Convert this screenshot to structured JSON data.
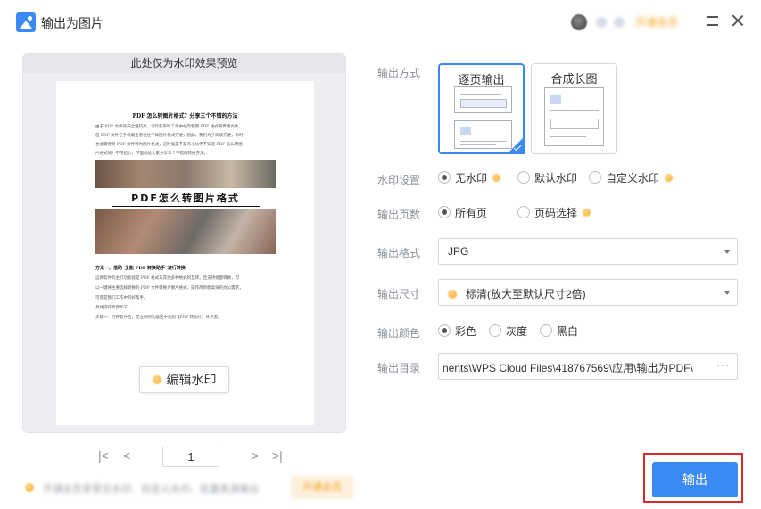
{
  "window": {
    "title": "输出为图片",
    "member_label": "开通会员"
  },
  "preview": {
    "header": "此处仅为水印效果预览",
    "doc": {
      "title": "PDF 怎么转图片格式？分享三个不错的方法",
      "intro_lines": [
        "由于 PDF 文件的安全性较高，读行在平时工作中经常使用 PDF 格式来传输文件。",
        "但 PDF 文件在手机端查看往往不如图片格式方便，因此，我们为了阅读方便，有时",
        "也会需要将 PDF 文件转为图片格式，这时候是不是有小伙伴不知道 PDF 怎么转图",
        "片格式呢？不用担心，下面就给大家分享三个不错的转换方法。"
      ],
      "banner": "PDF怎么转图片格式",
      "section_title": "方法一、借助“全能 PDF 转换助手”进行转换",
      "body_lines": [
        "这款软件的主打功能就是 PDF 格式与其他多种格式的互转，且支持批量转换，可",
        "以一键将主要选择转换的 PDF 文件转换为图片格式，操作简单能高效的办公需求，",
        "可谓是我们工作中的好帮手。",
        "具体操作步骤如下。",
        "步骤一：打开软件后，在左侧的功能区中找到【PDF 转图片】并点击。"
      ]
    },
    "edit_watermark_label": "编辑水印",
    "pager": {
      "first": "|<",
      "prev": "<",
      "page": "1",
      "next": ">",
      "last": ">|"
    },
    "vip_banner": {
      "text": "开通会员享受无水印、自定义水印、批量高清输出",
      "button": "开通会员"
    }
  },
  "form": {
    "output_mode": {
      "label": "输出方式",
      "options": [
        "逐页输出",
        "合成长图"
      ],
      "selected": "逐页输出"
    },
    "watermark": {
      "label": "水印设置",
      "options": [
        "无水印",
        "默认水印",
        "自定义水印"
      ],
      "selected": "无水印"
    },
    "pages": {
      "label": "输出页数",
      "options": [
        "所有页",
        "页码选择"
      ],
      "selected": "所有页"
    },
    "format": {
      "label": "输出格式",
      "value": "JPG"
    },
    "size": {
      "label": "输出尺寸",
      "value": "标清(放大至默认尺寸2倍)"
    },
    "color": {
      "label": "输出颜色",
      "options": [
        "彩色",
        "灰度",
        "黑白"
      ],
      "selected": "彩色"
    },
    "directory": {
      "label": "输出目录",
      "value": "nents\\WPS Cloud Files\\418767569\\应用\\输出为PDF\\",
      "more": "···"
    }
  },
  "export_label": "输出",
  "colors": {
    "accent": "#3b8af3",
    "vip": "#f5a623",
    "highlight_frame": "#d62b2b"
  }
}
